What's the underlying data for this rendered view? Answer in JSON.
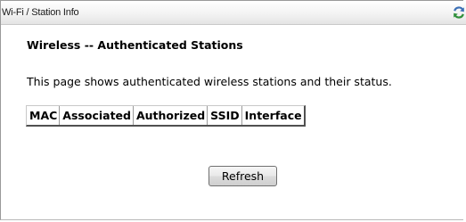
{
  "header": {
    "breadcrumb": "Wi-Fi / Station Info",
    "refresh_icon": "refresh-icon"
  },
  "main": {
    "heading": "Wireless -- Authenticated Stations",
    "description": "This page shows authenticated wireless stations and their status.",
    "table": {
      "columns": [
        "MAC",
        "Associated",
        "Authorized",
        "SSID",
        "Interface"
      ],
      "rows": []
    },
    "refresh_button_label": "Refresh"
  },
  "colors": {
    "title_bar_top": "#ffffff",
    "title_bar_bottom": "#e4e4e4",
    "icon_blue": "#3b6fb5",
    "icon_green": "#2f8f3a"
  }
}
